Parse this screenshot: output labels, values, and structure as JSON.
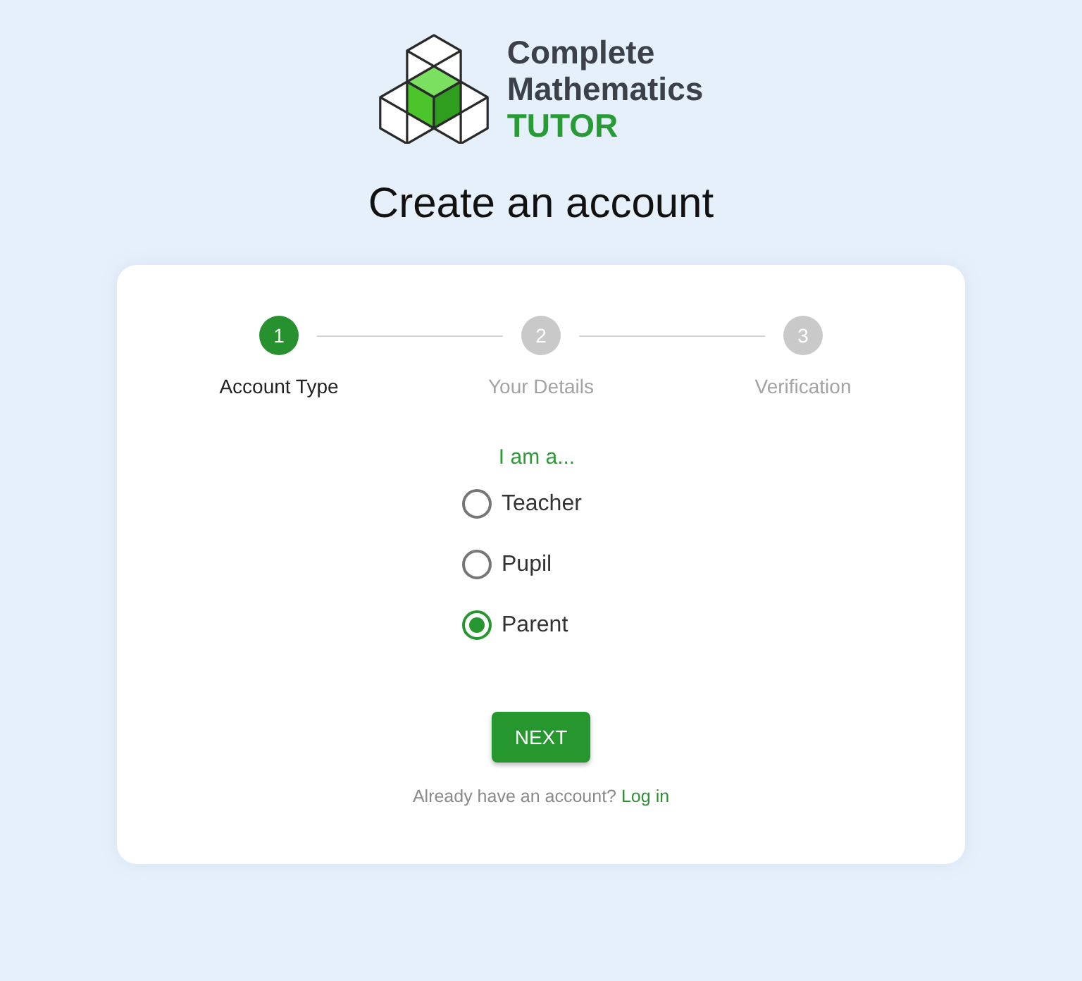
{
  "logo": {
    "name_lines": [
      "Complete",
      "Mathematics"
    ],
    "product": "TUTOR"
  },
  "title": "Create an account",
  "steps": [
    {
      "number": "1",
      "label": "Account Type",
      "selected": true
    },
    {
      "number": "2",
      "label": "Your Details",
      "selected": false
    },
    {
      "number": "3",
      "label": "Verification",
      "selected": false
    }
  ],
  "account_type": {
    "prompt": "I am a...",
    "options": [
      {
        "label": "Teacher",
        "selected": false
      },
      {
        "label": "Pupil",
        "selected": false
      },
      {
        "label": "Parent",
        "selected": true
      }
    ]
  },
  "next_button": "NEXT",
  "login_prompt": {
    "text": "Already have an account?",
    "link": "Log in"
  }
}
